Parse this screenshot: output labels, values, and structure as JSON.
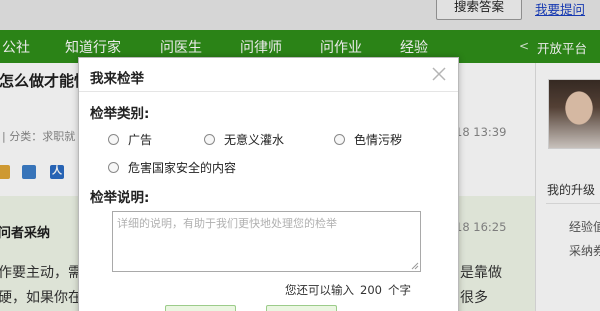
{
  "header": {
    "search_button": "搜索答案",
    "ask_link": "我要提问"
  },
  "nav": {
    "items": [
      "公社",
      "知道行家",
      "问医生",
      "问律师",
      "问作业",
      "经验"
    ],
    "open_platform": "开放平台"
  },
  "question": {
    "title_fragment": "怎么做才能忙",
    "category_fragment": "| 分类：求职就",
    "time": "18 13:39"
  },
  "answer": {
    "label": "问者采纳",
    "time": "18 16:25",
    "lines": [
      "作要主动，需",
      "硬，如果你在"
    ],
    "right_lines": [
      "是靠做",
      "很多"
    ]
  },
  "sidebar": {
    "upgrade_label": "我的升级",
    "item1": "经验值",
    "item2": "采纳券"
  },
  "dialog": {
    "title": "我来检举",
    "type_label": "检举类别:",
    "options": [
      "广告",
      "无意义灌水",
      "色情污秽",
      "危害国家安全的内容"
    ],
    "desc_label": "检举说明:",
    "desc_placeholder": "详细的说明，有助于我们更快地处理您的检举",
    "counter_prefix": "您还可以输入",
    "counter_value": "200",
    "counter_suffix": "个字"
  },
  "colors": {
    "nav_green": "#2f8f1a",
    "answer_bg": "#f0f7e9"
  }
}
